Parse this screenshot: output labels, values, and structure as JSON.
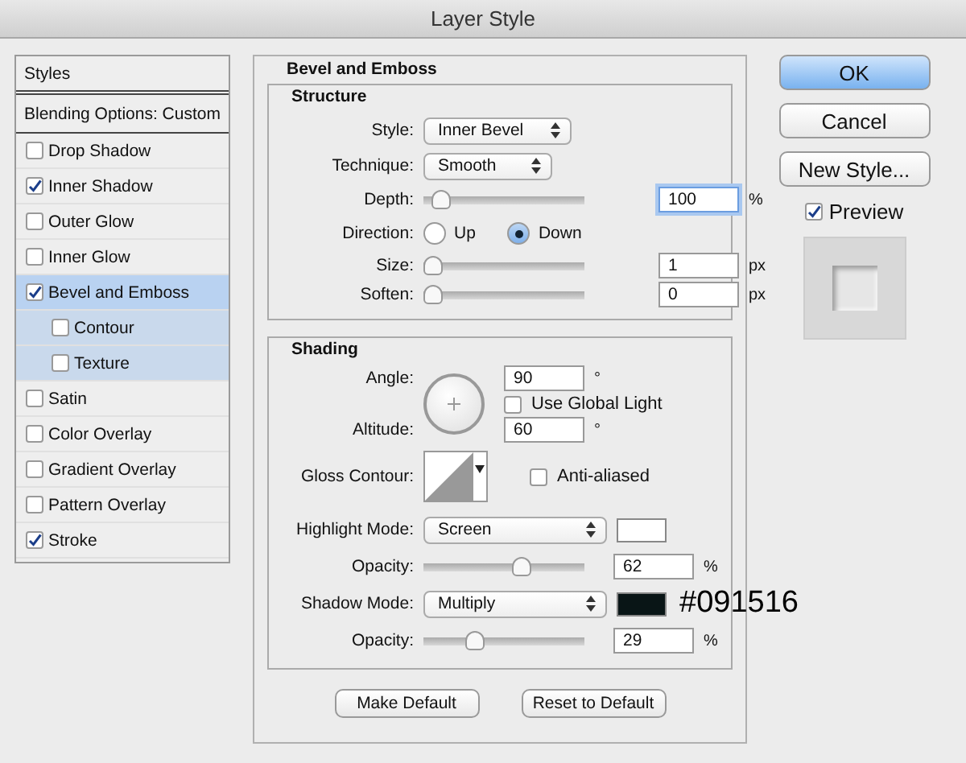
{
  "window": {
    "title": "Layer Style"
  },
  "sidebar": {
    "header": "Styles",
    "blending": "Blending Options: Custom",
    "items": [
      {
        "label": "Drop Shadow",
        "checked": false,
        "selected": false
      },
      {
        "label": "Inner Shadow",
        "checked": true,
        "selected": false
      },
      {
        "label": "Outer Glow",
        "checked": false,
        "selected": false
      },
      {
        "label": "Inner Glow",
        "checked": false,
        "selected": false
      },
      {
        "label": "Bevel and Emboss",
        "checked": true,
        "selected": true,
        "children": [
          {
            "label": "Contour",
            "checked": false,
            "selected": false
          },
          {
            "label": "Texture",
            "checked": false,
            "selected": false
          }
        ]
      },
      {
        "label": "Satin",
        "checked": false,
        "selected": false
      },
      {
        "label": "Color Overlay",
        "checked": false,
        "selected": false
      },
      {
        "label": "Gradient Overlay",
        "checked": false,
        "selected": false
      },
      {
        "label": "Pattern Overlay",
        "checked": false,
        "selected": false
      },
      {
        "label": "Stroke",
        "checked": true,
        "selected": false
      }
    ]
  },
  "panel": {
    "title": "Bevel and Emboss",
    "structure": {
      "title": "Structure",
      "rows": [
        {
          "kind": "select",
          "label": "Style:",
          "value": "Inner Bevel"
        },
        {
          "kind": "select",
          "label": "Technique:",
          "value": "Smooth"
        },
        {
          "kind": "slider",
          "label": "Depth:",
          "level": 0.06,
          "value": "100",
          "unit": "%",
          "focused": true
        },
        {
          "kind": "radio",
          "label": "Direction:",
          "options": [
            {
              "label": "Up",
              "selected": false
            },
            {
              "label": "Down",
              "selected": true
            }
          ]
        },
        {
          "kind": "slider",
          "label": "Size:",
          "level": 0,
          "value": "1",
          "unit": "px",
          "focused": false
        },
        {
          "kind": "slider",
          "label": "Soften:",
          "level": 0,
          "value": "0",
          "unit": "px",
          "focused": false
        }
      ]
    },
    "shading": {
      "title": "Shading",
      "angle": {
        "label": "Angle:",
        "value": "90",
        "unit": "°"
      },
      "global_light": {
        "label": "Use Global Light",
        "checked": false
      },
      "altitude": {
        "label": "Altitude:",
        "value": "60",
        "unit": "°"
      },
      "gloss_contour": {
        "label": "Gloss Contour:"
      },
      "anti_aliased": {
        "label": "Anti-aliased",
        "checked": false
      },
      "rows": [
        {
          "kind": "mode",
          "label": "Highlight Mode:",
          "value": "Screen",
          "color": "#ffffff"
        },
        {
          "kind": "slider",
          "label": "Opacity:",
          "level": 0.62,
          "value": "62",
          "unit": "%"
        },
        {
          "kind": "mode",
          "label": "Shadow Mode:",
          "value": "Multiply",
          "color": "#091516",
          "annotation": "#091516"
        },
        {
          "kind": "slider",
          "label": "Opacity:",
          "level": 0.29,
          "value": "29",
          "unit": "%"
        }
      ]
    },
    "buttons": [
      "Make Default",
      "Reset to Default"
    ]
  },
  "actions": [
    {
      "label": "OK",
      "default": true
    },
    {
      "label": "Cancel",
      "default": false
    },
    {
      "label": "New Style...",
      "default": false
    }
  ],
  "preview": {
    "label": "Preview",
    "checked": true
  }
}
